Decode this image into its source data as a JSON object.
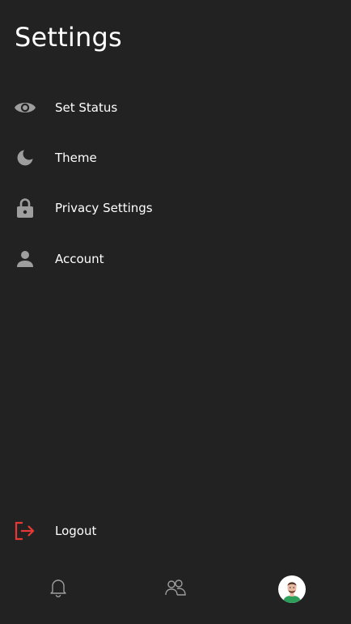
{
  "header": {
    "title": "Settings"
  },
  "menu": {
    "items": [
      {
        "label": "Set Status",
        "icon": "eye-icon"
      },
      {
        "label": "Theme",
        "icon": "moon-icon"
      },
      {
        "label": "Privacy Settings",
        "icon": "lock-icon"
      },
      {
        "label": "Account",
        "icon": "person-icon"
      }
    ]
  },
  "logout": {
    "label": "Logout",
    "icon": "logout-icon",
    "color": "#e53935"
  },
  "bottom_nav": {
    "items": [
      {
        "icon": "bell-icon"
      },
      {
        "icon": "people-icon"
      },
      {
        "icon": "profile-avatar"
      }
    ]
  },
  "colors": {
    "background": "#222222",
    "icon_gray": "#9e9e9e",
    "text": "#ffffff",
    "avatar_shirt": "#2e9e5b"
  }
}
